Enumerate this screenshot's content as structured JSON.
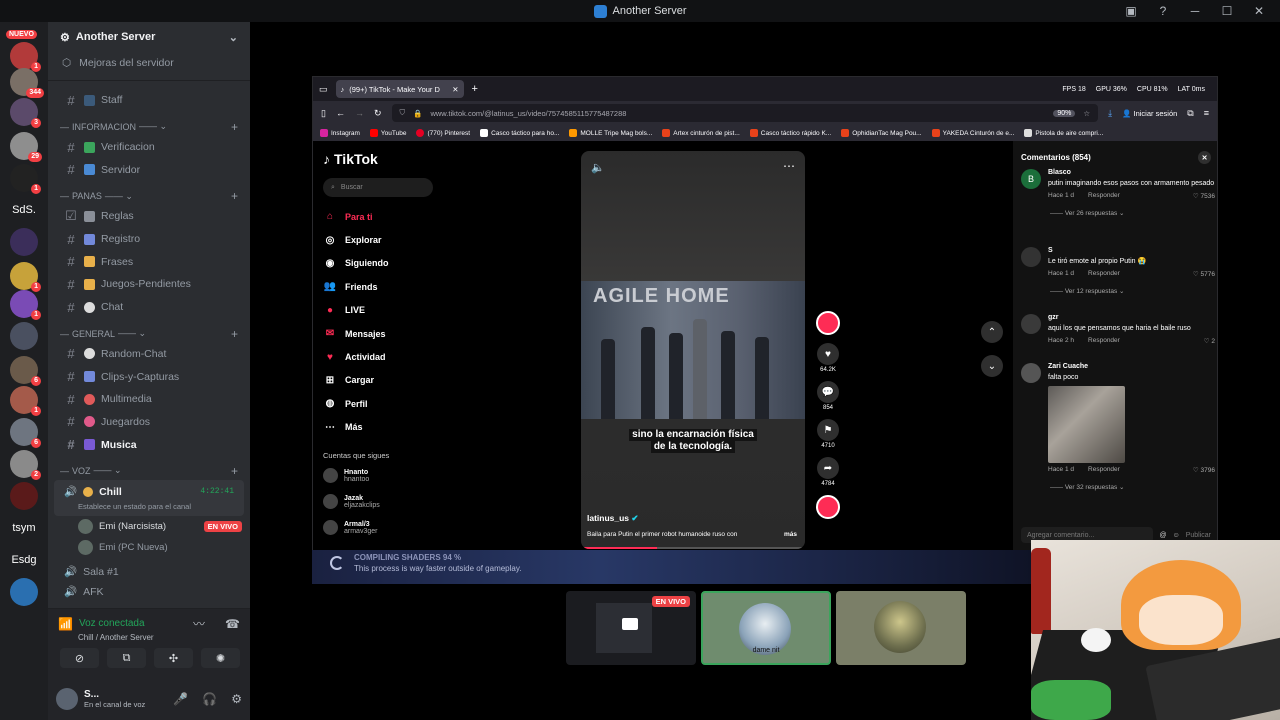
{
  "window": {
    "title": "Another Server"
  },
  "guilds": {
    "nuevo_badge": "NUEVO",
    "badges": [
      "1",
      "344",
      "3",
      "29",
      "1",
      "1",
      "1",
      "6",
      "1",
      "6",
      "2"
    ],
    "text_guilds": [
      "SdS.",
      "tsym",
      "Esdg"
    ]
  },
  "sidebar": {
    "server_name": "Another Server",
    "boost": "Mejoras del servidor",
    "staff": "Staff",
    "categories": {
      "informacion": "INFORMACION",
      "panas": "PANAS",
      "general": "GENERAL",
      "voz": "VOZ"
    },
    "info_channels": [
      "Verificacion",
      "Servidor"
    ],
    "panas_channels": [
      "Reglas",
      "Registro",
      "Frases",
      "Juegos-Pendientes",
      "Chat"
    ],
    "general_channels": [
      "Random-Chat",
      "Clips-y-Capturas",
      "Multimedia",
      "Juegardos",
      "Musica"
    ],
    "voice": {
      "chill": "Chill",
      "chill_time": "4:22:41",
      "chill_status": "Establece un estado para el canal",
      "users": [
        {
          "name": "Emi (Narcisista)",
          "badge": "EN VIVO"
        },
        {
          "name": "Emi (PC Nueva)"
        }
      ],
      "sala1": "Sala #1",
      "afk": "AFK"
    }
  },
  "voice_panel": {
    "title": "Voz conectada",
    "subtitle": "Chill / Another Server"
  },
  "user_panel": {
    "name": "S...",
    "status": "En el canal de voz"
  },
  "browser": {
    "tab_title": "(99+) TikTok - Make Your D",
    "perf": [
      "FPS 18",
      "GPU 36%",
      "CPU 81%",
      "LAT 0ms"
    ],
    "url": "www.tiktok.com/@latinus_us/video/7574585115775487288",
    "zoom": "90%",
    "signin": "Iniciar sesión",
    "bookmarks": [
      "Instagram",
      "YouTube",
      "(770) Pinterest",
      "Casco táctico para ho...",
      "MOLLE Tripe Mag bols...",
      "Artex cinturón de pist...",
      "Casco táctico rápido K...",
      "OphidianTac Mag Pou...",
      "YAKEDA Cinturón de e...",
      "Pistola de aire compri..."
    ]
  },
  "tiktok": {
    "logo": "TikTok",
    "search_placeholder": "Buscar",
    "nav": [
      "Para ti",
      "Explorar",
      "Siguiendo",
      "Friends",
      "LIVE",
      "Mensajes",
      "Actividad",
      "Cargar",
      "Perfil",
      "Más"
    ],
    "following_header": "Cuentas que sigues",
    "following": [
      {
        "name": "Hnanto",
        "handle": "hnantoo"
      },
      {
        "name": "Jazak",
        "handle": "eljazakclips"
      },
      {
        "name": "Armal/3",
        "handle": "armav3ger"
      }
    ],
    "video": {
      "sign": "AGILE HOME",
      "caption_line1": "sino la encarnación física",
      "caption_line2": "de la tecnología.",
      "author": "latinus_us",
      "description": "Baila para Putin el primer robot humanoide ruso con",
      "more": "más",
      "progress": 0.34
    },
    "actions": {
      "likes": "64.2K",
      "comments": "854",
      "saves": "4710",
      "shares": "4784"
    },
    "comments_title": "Comentarios (854)",
    "comments": [
      {
        "initial": "B",
        "user": "Blasco",
        "text": "putin imaginando esos pasos con armamento pesado",
        "time": "Hace 1 d",
        "reply": "Responder",
        "likes": "7536",
        "replies": "Ver 26 respuestas"
      },
      {
        "user": "S",
        "text": "Le tiró emote al propio Putin 😭",
        "time": "Hace 1 d",
        "reply": "Responder",
        "likes": "5776",
        "replies": "Ver 12 respuestas"
      },
      {
        "user": "gzr",
        "text": "aqui los que pensamos que haria el baile ruso",
        "time": "Hace 2 h",
        "reply": "Responder",
        "likes": "2"
      },
      {
        "user": "Zari Cuache",
        "text": "falta poco",
        "time": "Hace 1 d",
        "reply": "Responder",
        "likes": "3796",
        "replies": "Ver 32 respuestas"
      }
    ],
    "add_comment": "Agregar comentario...",
    "publish": "Publicar"
  },
  "game_banner": {
    "line1": "COMPILING SHADERS 94 %",
    "line2": "This process is way faster outside of gameplay."
  },
  "streams": {
    "live_badge": "EN VIVO",
    "user2": "dame nit"
  }
}
